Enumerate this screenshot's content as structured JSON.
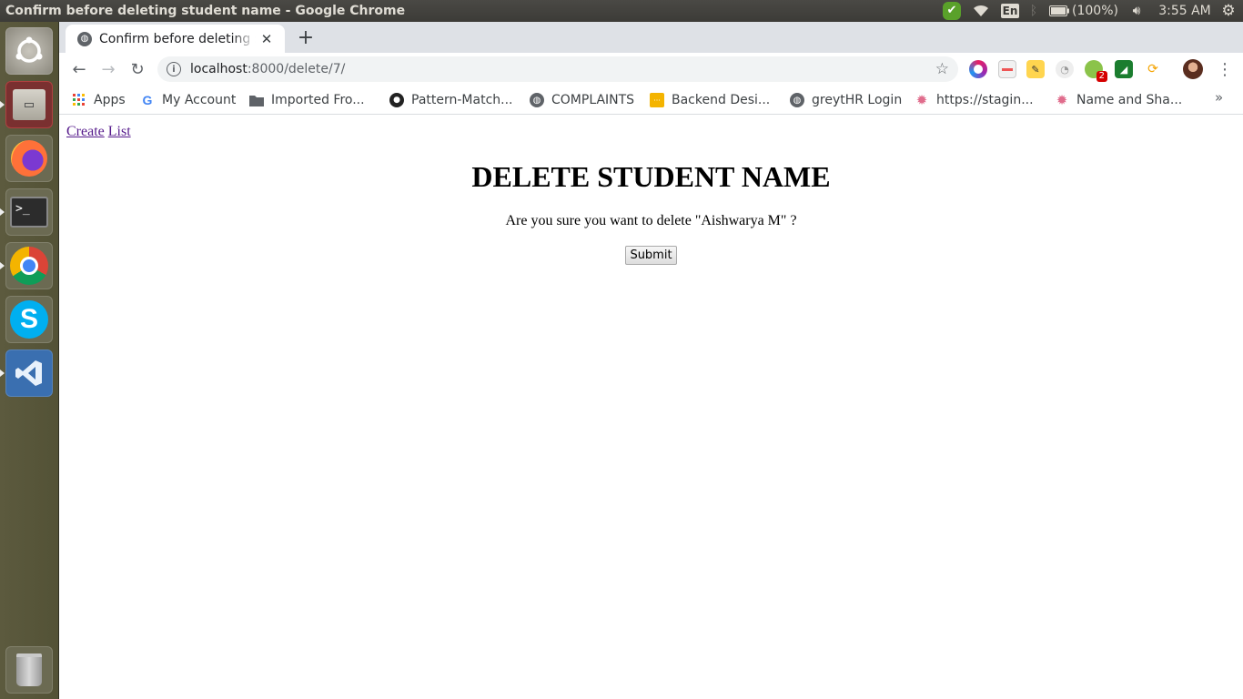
{
  "window_title": "Confirm before deleting student name - Google Chrome",
  "top_panel": {
    "keyboard_layout": "En",
    "battery": "(100%)",
    "clock": "3:55 AM"
  },
  "launcher": {
    "items": [
      "Ubuntu Dash",
      "Files",
      "Firefox",
      "Terminal",
      "Google Chrome",
      "Skype",
      "Visual Studio Code",
      "Trash"
    ]
  },
  "browser": {
    "tab": {
      "title": "Confirm before deleting student name"
    },
    "url_host": "localhost",
    "url_rest": ":8000/delete/7/",
    "extensions_badge": "2",
    "bookmarks": [
      {
        "label": "Apps",
        "icon": "apps-grid-icon"
      },
      {
        "label": "My Account",
        "icon": "google-g-icon"
      },
      {
        "label": "Imported Fro...",
        "icon": "folder-icon"
      },
      {
        "label": "Pattern-Match...",
        "icon": "github-icon"
      },
      {
        "label": "COMPLAINTS",
        "icon": "globe-icon"
      },
      {
        "label": "Backend Desi...",
        "icon": "slides-icon"
      },
      {
        "label": "greytHR Login",
        "icon": "globe-icon"
      },
      {
        "label": "https://stagin...",
        "icon": "gear-pink-icon"
      },
      {
        "label": "Name and Sha...",
        "icon": "gear-pink-icon"
      }
    ]
  },
  "page": {
    "nav": {
      "create": "Create",
      "list": "List"
    },
    "title": "DELETE STUDENT NAME",
    "confirm_text": "Are you sure you want to delete \"Aishwarya M\" ?",
    "submit_label": "Submit"
  },
  "colors": {
    "link_visited": "#551a8b",
    "panel_bg": "#3c3b37",
    "launcher_bg": "#5c5a3e"
  }
}
